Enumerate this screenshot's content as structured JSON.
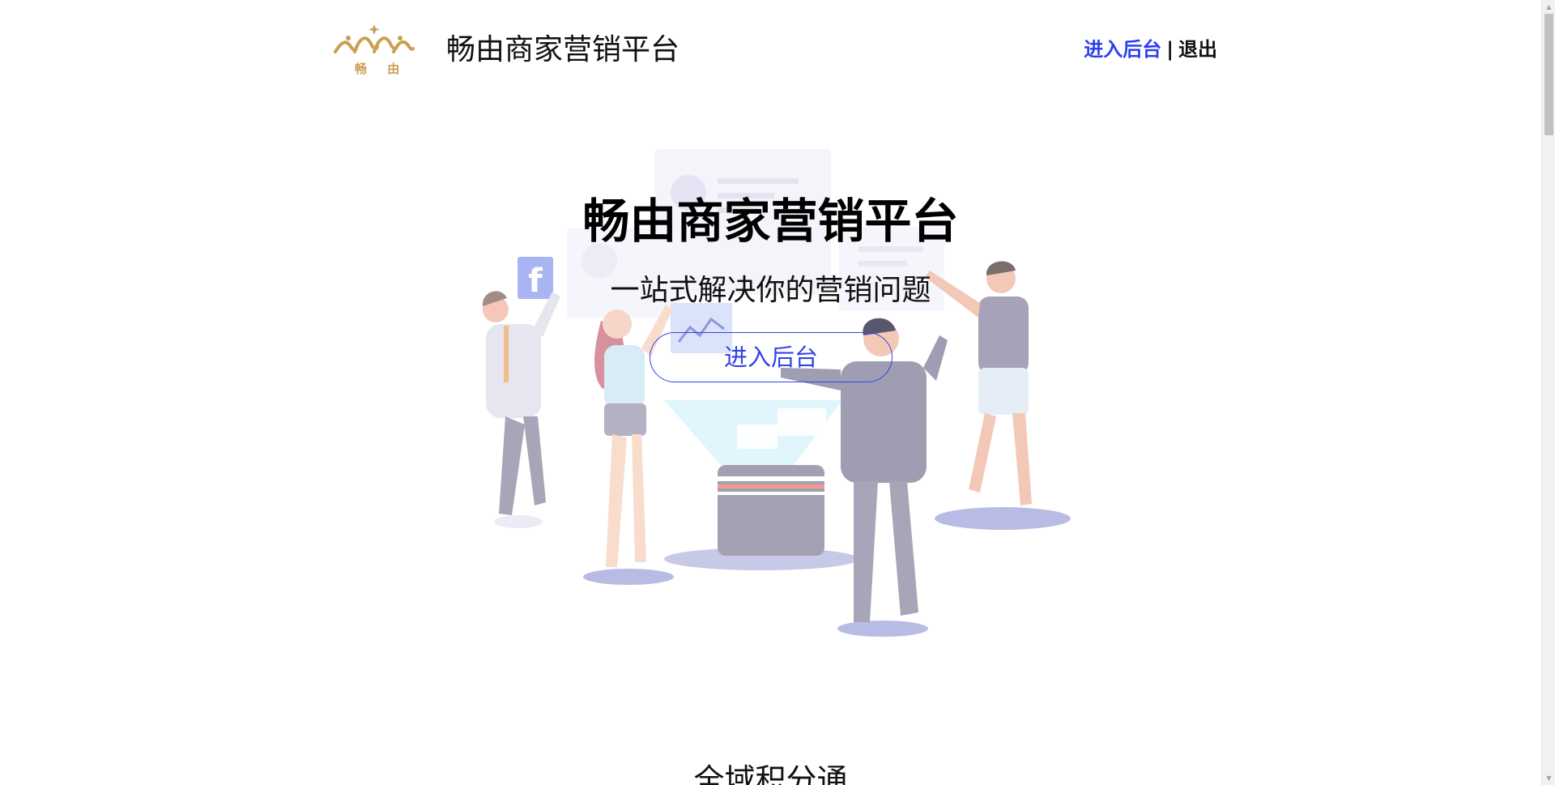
{
  "header": {
    "logo_text": "畅 由",
    "site_title": "畅由商家营销平台",
    "nav": {
      "enter_admin": "进入后台",
      "separator": "|",
      "logout": "退出"
    }
  },
  "hero": {
    "title": "畅由商家营销平台",
    "subtitle": "一站式解决你的营销问题",
    "button_label": "进入后台"
  },
  "next_section": {
    "heading": "全域积分通"
  },
  "colors": {
    "accent_blue": "#2d3ef0",
    "logo_gold": "#c9a052"
  }
}
